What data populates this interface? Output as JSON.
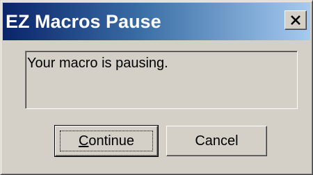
{
  "window": {
    "title": "EZ Macros Pause",
    "close_label": "Close"
  },
  "message": {
    "text": "Your macro is pausing."
  },
  "buttons": {
    "continue_mnemonic": "C",
    "continue_rest": "ontinue",
    "cancel_label": "Cancel"
  },
  "colors": {
    "title_start": "#0a246a",
    "title_end": "#a6caf0",
    "face": "#d4d0c8"
  },
  "icons": {
    "close": "close-icon"
  }
}
